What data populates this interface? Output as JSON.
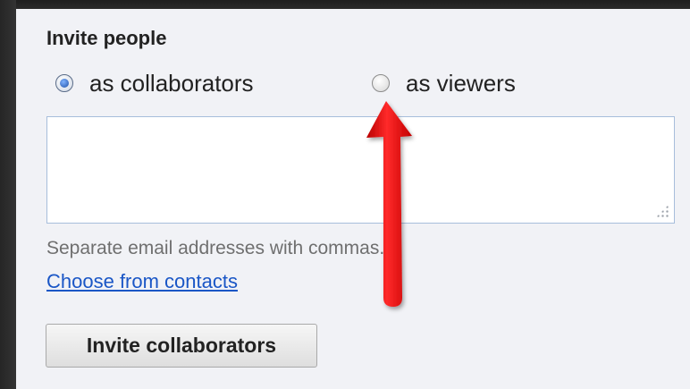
{
  "heading": "Invite people",
  "roles": [
    {
      "label": "as collaborators",
      "checked": true
    },
    {
      "label": "as viewers",
      "checked": false
    }
  ],
  "emails_input": {
    "value": "",
    "placeholder": ""
  },
  "hint": "Separate email addresses with commas.",
  "contacts_link": "Choose from contacts",
  "invite_button": "Invite collaborators",
  "colors": {
    "link": "#1a56c6",
    "arrow": "#e20000",
    "panel": "#f1f2f6"
  },
  "annotation": {
    "icon": "red-arrow-icon"
  }
}
